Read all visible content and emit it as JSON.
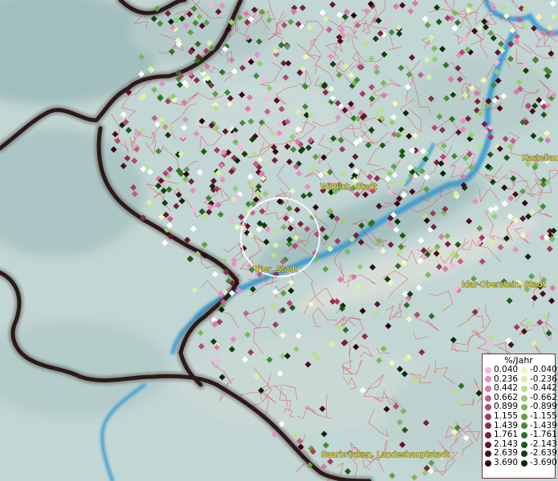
{
  "legend": {
    "title": "%/Jahr",
    "positive": [
      {
        "label": "0.040",
        "color": "#f4b6dc"
      },
      {
        "label": "0.236",
        "color": "#e78fc0"
      },
      {
        "label": "0.442",
        "color": "#d97aa8"
      },
      {
        "label": "0.662",
        "color": "#c65e8a"
      },
      {
        "label": "0.899",
        "color": "#b34a72"
      },
      {
        "label": "1.155",
        "color": "#a13c60"
      },
      {
        "label": "1.439",
        "color": "#8c2c4c"
      },
      {
        "label": "1.761",
        "color": "#7a203c"
      },
      {
        "label": "2.143",
        "color": "#62142c"
      },
      {
        "label": "2.639",
        "color": "#4a0c20"
      },
      {
        "label": "3.690",
        "color": "#300614"
      }
    ],
    "negative": [
      {
        "label": "-0.040",
        "color": "#eef8c0"
      },
      {
        "label": "-0.236",
        "color": "#d9f0a4"
      },
      {
        "label": "-0.442",
        "color": "#b9e08a"
      },
      {
        "label": "-0.662",
        "color": "#98cc72"
      },
      {
        "label": "-0.899",
        "color": "#7ab85c"
      },
      {
        "label": "-1.155",
        "color": "#5ea048"
      },
      {
        "label": "-1.439",
        "color": "#468838"
      },
      {
        "label": "-1.761",
        "color": "#307028"
      },
      {
        "label": "-2.143",
        "color": "#1e5818"
      },
      {
        "label": "-2.639",
        "color": "#10400c"
      },
      {
        "label": "-3.690",
        "color": "#062a06"
      }
    ]
  },
  "places": [
    {
      "name": "Wittlich, Stadt"
    },
    {
      "name": "Trier, Stadt"
    },
    {
      "name": "Kastellaun"
    },
    {
      "name": "Idar-Oberstein, Stadt"
    },
    {
      "name": "Saarbrücken, Landeshauptstadt"
    }
  ]
}
